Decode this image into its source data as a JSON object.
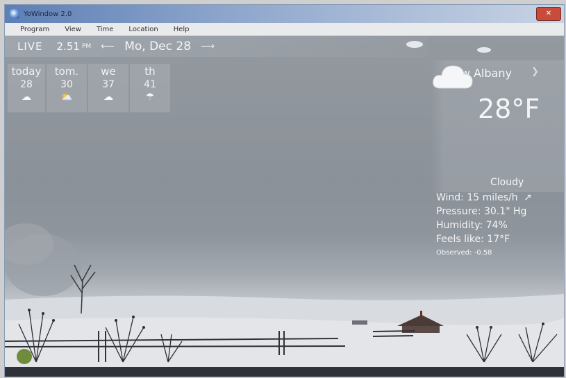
{
  "window": {
    "title": "YoWindow 2.0",
    "close_icon": "close-icon",
    "close_color": "#c84b3b"
  },
  "menu": {
    "items": [
      "Program",
      "View",
      "Time",
      "Location",
      "Help"
    ]
  },
  "timebar": {
    "mode": "LIVE",
    "time": "2.51",
    "ampm": "PM",
    "date": "Mo, Dec 28",
    "back_icon": "arrow-left-icon",
    "forward_icon": "arrow-right-icon"
  },
  "forecast": [
    {
      "label": "today",
      "temp": "28",
      "icon": "cloud-icon"
    },
    {
      "label": "tom.",
      "temp": "30",
      "icon": "cloud-sun-icon"
    },
    {
      "label": "we",
      "temp": "37",
      "icon": "cloud-icon"
    },
    {
      "label": "th",
      "temp": "41",
      "icon": "cloud-rain-icon"
    }
  ],
  "current": {
    "location": "New Albany",
    "location_nav_icon": "chevron-right-icon",
    "temperature": "28°F",
    "condition": "Cloudy",
    "condition_icon": "cloud-icon",
    "wind_label": "Wind:",
    "wind_value": "15 miles/h",
    "wind_icon": "arrow-up-right-icon",
    "pressure_label": "Pressure:",
    "pressure_value": "30.1\" Hg",
    "humidity_label": "Humidity:",
    "humidity_value": "74%",
    "feels_label": "Feels like:",
    "feels_value": "17°F",
    "observed_label": "Observed:",
    "observed_value": "-0.58"
  },
  "colors": {
    "sky": "#8d949c",
    "snow": "#d9dce1",
    "text": "#f4f5f7",
    "titlebar": "#5d7fb4"
  }
}
